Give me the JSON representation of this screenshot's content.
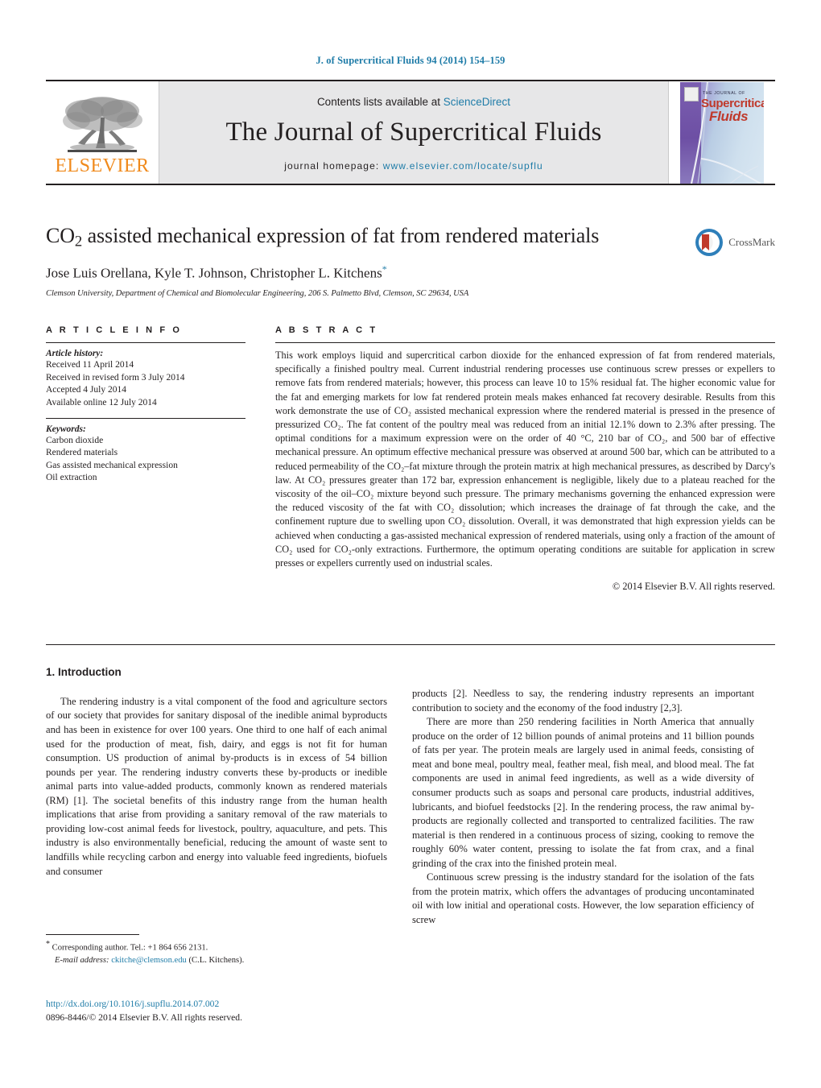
{
  "running_head": "J. of Supercritical Fluids 94 (2014) 154–159",
  "masthead": {
    "publisher_logo_name": "elsevier-tree-logo",
    "publisher_wordmark": "ELSEVIER",
    "contents_prefix": "Contents lists available at ",
    "contents_link": "ScienceDirect",
    "journal_title": "The Journal of Supercritical Fluids",
    "homepage_prefix": "journal homepage: ",
    "homepage_url": "www.elsevier.com/locate/supflu",
    "cover": {
      "line1": "THE JOURNAL OF",
      "line2": "Supercritical",
      "line3": "Fluids"
    }
  },
  "article": {
    "title_part1": "CO",
    "title_sub": "2",
    "title_part2": " assisted mechanical expression of fat from rendered materials",
    "authors": "Jose Luis Orellana, Kyle T. Johnson, Christopher L. Kitchens",
    "corresponding_marker": "*",
    "affiliation": "Clemson University, Department of Chemical and Biomolecular Engineering, 206 S. Palmetto Blvd, Clemson, SC 29634, USA",
    "crossmark_label": "CrossMark"
  },
  "article_info": {
    "heading": "A R T I C L E    I N F O",
    "history_label": "Article history:",
    "history": [
      "Received 11 April 2014",
      "Received in revised form 3 July 2014",
      "Accepted 4 July 2014",
      "Available online 12 July 2014"
    ],
    "keywords_label": "Keywords:",
    "keywords": [
      "Carbon dioxide",
      "Rendered materials",
      "Gas assisted mechanical expression",
      "Oil extraction"
    ]
  },
  "abstract": {
    "heading": "A B S T R A C T",
    "text": "This work employs liquid and supercritical carbon dioxide for the enhanced expression of fat from rendered materials, specifically a finished poultry meal. Current industrial rendering processes use continuous screw presses or expellers to remove fats from rendered materials; however, this process can leave 10 to 15% residual fat. The higher economic value for the fat and emerging markets for low fat rendered protein meals makes enhanced fat recovery desirable. Results from this work demonstrate the use of CO₂ assisted mechanical expression where the rendered material is pressed in the presence of pressurized CO₂. The fat content of the poultry meal was reduced from an initial 12.1% down to 2.3% after pressing. The optimal conditions for a maximum expression were on the order of 40 °C, 210 bar of CO₂, and 500 bar of effective mechanical pressure. An optimum effective mechanical pressure was observed at around 500 bar, which can be attributed to a reduced permeability of the CO₂–fat mixture through the protein matrix at high mechanical pressures, as described by Darcy's law. At CO₂ pressures greater than 172 bar, expression enhancement is negligible, likely due to a plateau reached for the viscosity of the oil–CO₂ mixture beyond such pressure. The primary mechanisms governing the enhanced expression were the reduced viscosity of the fat with CO₂ dissolution; which increases the drainage of fat through the cake, and the confinement rupture due to swelling upon CO₂ dissolution. Overall, it was demonstrated that high expression yields can be achieved when conducting a gas-assisted mechanical expression of rendered materials, using only a fraction of the amount of CO₂ used for CO₂-only extractions. Furthermore, the optimum operating conditions are suitable for application in screw presses or expellers currently used on industrial scales.",
    "copyright": "© 2014 Elsevier B.V. All rights reserved."
  },
  "introduction": {
    "heading": "1. Introduction",
    "left_paragraphs": [
      "The rendering industry is a vital component of the food and agriculture sectors of our society that provides for sanitary disposal of the inedible animal byproducts and has been in existence for over 100 years. One third to one half of each animal used for the production of meat, fish, dairy, and eggs is not fit for human consumption. US production of animal by-products is in excess of 54 billion pounds per year. The rendering industry converts these by-products or inedible animal parts into value-added products, commonly known as rendered materials (RM) [1]. The societal benefits of this industry range from the human health implications that arise from providing a sanitary removal of the raw materials to providing low-cost animal feeds for livestock, poultry, aquaculture, and pets. This industry is also environmentally beneficial, reducing the amount of waste sent to landfills while recycling carbon and energy into valuable feed ingredients, biofuels and consumer"
    ],
    "right_paragraphs": [
      "products [2]. Needless to say, the rendering industry represents an important contribution to society and the economy of the food industry [2,3].",
      "There are more than 250 rendering facilities in North America that annually produce on the order of 12 billion pounds of animal proteins and 11 billion pounds of fats per year. The protein meals are largely used in animal feeds, consisting of meat and bone meal, poultry meal, feather meal, fish meal, and blood meal. The fat components are used in animal feed ingredients, as well as a wide diversity of consumer products such as soaps and personal care products, industrial additives, lubricants, and biofuel feedstocks [2]. In the rendering process, the raw animal by-products are regionally collected and transported to centralized facilities. The raw material is then rendered in a continuous process of sizing, cooking to remove the roughly 60% water content, pressing to isolate the fat from crax, and a final grinding of the crax into the finished protein meal.",
      "Continuous screw pressing is the industry standard for the isolation of the fats from the protein matrix, which offers the advantages of producing uncontaminated oil with low initial and operational costs. However, the low separation efficiency of screw"
    ]
  },
  "footnotes": {
    "corresponding": "Corresponding author. Tel.: +1 864 656 2131.",
    "email_label": "E-mail address:",
    "email": "ckitche@clemson.edu",
    "email_suffix": "(C.L. Kitchens).",
    "doi": "http://dx.doi.org/10.1016/j.supflu.2014.07.002",
    "issn_line": "0896-8446/© 2014 Elsevier B.V. All rights reserved."
  },
  "colors": {
    "link": "#1f7ca8",
    "elsevier_orange": "#f08a1c",
    "masthead_bg": "#e7e7e8",
    "crossmark_blue": "#2e7fba",
    "crossmark_red": "#c0392b"
  }
}
